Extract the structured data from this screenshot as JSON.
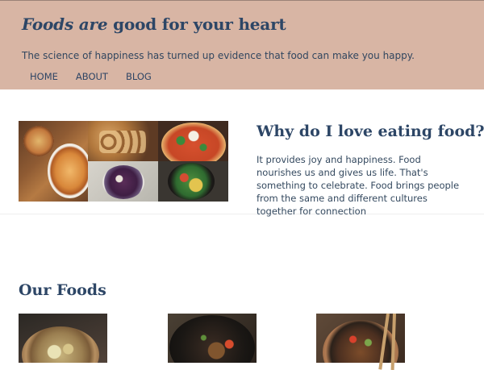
{
  "header": {
    "title_emphasis": "Foods are",
    "title_rest": " good for your heart",
    "tagline": "The science of happiness has turned up evidence that food can make you happy.",
    "nav": [
      {
        "label": "HOME"
      },
      {
        "label": "ABOUT"
      },
      {
        "label": "BLOG"
      }
    ]
  },
  "hero": {
    "heading": "Why do I love eating food?",
    "text": "It provides joy and happiness. Food nourishes us and gives us life. That's something to celebrate. Food brings people from the same and different cultures together for connection"
  },
  "foods": {
    "heading": "Our Foods"
  },
  "colors": {
    "header_background": "#d8b5a4",
    "heading": "#2d4666",
    "body_text": "#34495f"
  }
}
